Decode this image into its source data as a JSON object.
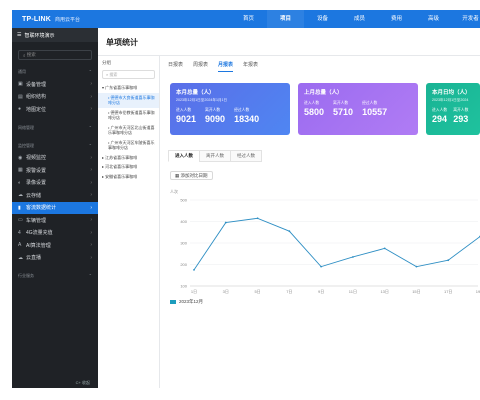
{
  "app": {
    "logo": "TP-LINK",
    "subtitle": "商用云平台"
  },
  "nav": [
    "首页",
    "项目",
    "设备",
    "成员",
    "费用",
    "高级",
    "开发者"
  ],
  "nav_active_index": 1,
  "sidebar": {
    "header": "智联环境演示",
    "search_placeholder": "搜索",
    "group1": "通用",
    "items1": [
      {
        "icon": "device-icon",
        "glyph": "▣",
        "label": "设备管理"
      },
      {
        "icon": "org-icon",
        "glyph": "▤",
        "label": "组织结构"
      },
      {
        "icon": "location-icon",
        "glyph": "●",
        "label": "地图定位"
      }
    ],
    "group2": "网络管理",
    "group3": "监控管理",
    "items3": [
      {
        "icon": "video-icon",
        "glyph": "◉",
        "label": "视频监控"
      },
      {
        "icon": "alarm-icon",
        "glyph": "▦",
        "label": "报警设置"
      },
      {
        "icon": "record-icon",
        "glyph": "◐",
        "label": "录像设置"
      },
      {
        "icon": "cloud-storage-icon",
        "glyph": "☁",
        "label": "云存储"
      },
      {
        "icon": "stats-icon",
        "glyph": "▮",
        "label": "客流数据统计",
        "active": true
      },
      {
        "icon": "vehicle-icon",
        "glyph": "▭",
        "label": "车辆管理"
      },
      {
        "icon": "4g-icon",
        "glyph": "4",
        "label": "4G流量充值"
      },
      {
        "icon": "ai-icon",
        "glyph": "A",
        "label": "AI算法管理"
      },
      {
        "icon": "cloud-icon",
        "glyph": "☁",
        "label": "云直播"
      }
    ],
    "group4": "行业服务",
    "footer": "C+ 收起"
  },
  "page": {
    "title": "单项统计"
  },
  "org": {
    "title": "分组",
    "search_placeholder": "搜索",
    "tree": [
      {
        "label": "▾ 广东省喜乐事咖啡",
        "level": 0
      },
      {
        "label": "• 德德市大良街道喜乐事咖啡分店",
        "level": 1,
        "selected": true
      },
      {
        "label": "• 德德市伦教街道喜乐事咖啡分店",
        "level": 1
      },
      {
        "label": "• 广州市天河区北山街道喜乐事咖啡分店",
        "level": 1
      },
      {
        "label": "• 广州市天河区车陂街喜乐事咖啡分店",
        "level": 1
      },
      {
        "label": "▸ 江苏省喜乐事咖啡",
        "level": 0
      },
      {
        "label": "▸ 河北省喜乐事咖啡",
        "level": 0
      },
      {
        "label": "▸ 安徽省喜乐事咖啡",
        "level": 0
      }
    ]
  },
  "tabs": [
    "日报表",
    "周报表",
    "月报表",
    "年报表"
  ],
  "tabs_active_index": 2,
  "cards": [
    {
      "title": "本月总量（人）",
      "date": "2023年12月1日至2024年1月1日",
      "stats": [
        {
          "label": "进入人数",
          "value": "9021"
        },
        {
          "label": "离开人数",
          "value": "9090"
        },
        {
          "label": "经过人数",
          "value": "18340"
        }
      ]
    },
    {
      "title": "上月总量（人）",
      "date": "",
      "stats": [
        {
          "label": "进入人数",
          "value": "5800"
        },
        {
          "label": "离开人数",
          "value": "5710"
        },
        {
          "label": "经过人数",
          "value": "10557"
        }
      ]
    },
    {
      "title": "本月日均（人）",
      "date": "2023年12月1日至2024",
      "stats": [
        {
          "label": "进入人数",
          "value": "294"
        },
        {
          "label": "离开人数",
          "value": "293"
        }
      ]
    }
  ],
  "subtabs": [
    "进入人数",
    "离开人数",
    "经过人数"
  ],
  "subtabs_active_index": 0,
  "add_button": "添加对比日期",
  "colors": {
    "brand": "#1c77e0",
    "line": "#2f8fc4",
    "sidebar_bg": "#1f2226"
  },
  "chart_data": {
    "type": "line",
    "ylabel": "人次",
    "ylim": [
      100,
      500
    ],
    "yticks": [
      100,
      200,
      300,
      400,
      500
    ],
    "x": [
      "1日",
      "3日",
      "5日",
      "7日",
      "9日",
      "11日",
      "13日",
      "15日",
      "17日",
      "19日"
    ],
    "series": [
      {
        "name": "2023年12月",
        "values": [
          175,
          395,
          415,
          355,
          190,
          235,
          275,
          190,
          220,
          330
        ]
      }
    ]
  }
}
